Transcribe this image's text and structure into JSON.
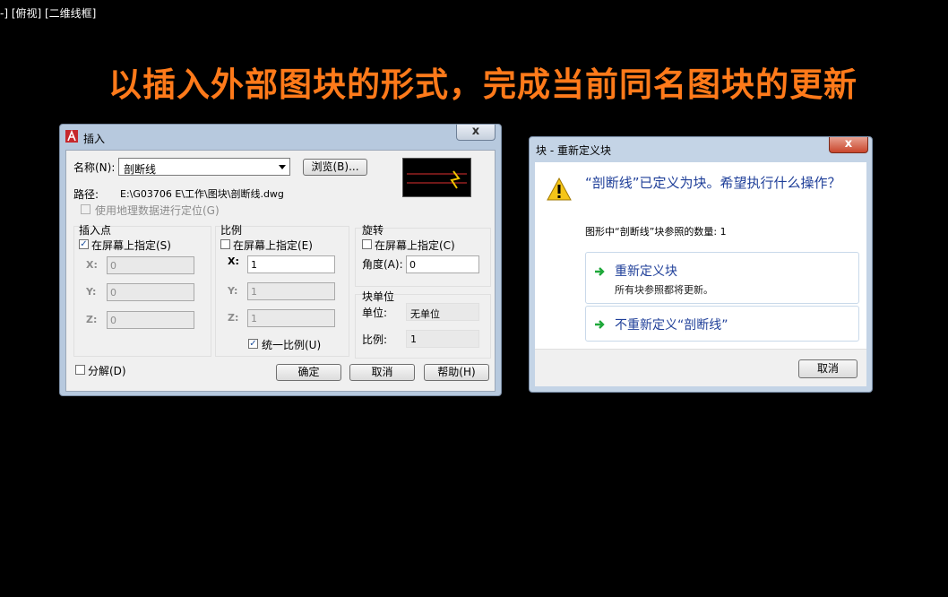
{
  "viewport_label": "-] [俯视] [二维线框]",
  "headline": "以插入外部图块的形式，完成当前同名图块的更新",
  "insert_dialog": {
    "title": "插入",
    "close_symbol": "x",
    "name_label": "名称(N):",
    "name_value": "剖断线",
    "browse_label": "浏览(B)...",
    "path_label": "路径:",
    "path_value": "E:\\G03706 E\\工作\\图块\\剖断线.dwg",
    "geo_label": "使用地理数据进行定位(G)",
    "insertion_point": {
      "title": "插入点",
      "specify_label": "在屏幕上指定(S)",
      "specify_checked": true,
      "x_label": "X:",
      "x_value": "0",
      "y_label": "Y:",
      "y_value": "0",
      "z_label": "Z:",
      "z_value": "0"
    },
    "scale": {
      "title": "比例",
      "specify_label": "在屏幕上指定(E)",
      "specify_checked": false,
      "x_label": "X:",
      "x_value": "1",
      "y_label": "Y:",
      "y_value": "1",
      "z_label": "Z:",
      "z_value": "1",
      "uniform_label": "统一比例(U)",
      "uniform_checked": true
    },
    "rotation": {
      "title": "旋转",
      "specify_label": "在屏幕上指定(C)",
      "specify_checked": false,
      "angle_label": "角度(A):",
      "angle_value": "0"
    },
    "block_unit": {
      "title": "块单位",
      "unit_label": "单位:",
      "unit_value": "无单位",
      "factor_label": "比例:",
      "factor_value": "1"
    },
    "explode_label": "分解(D)",
    "explode_checked": false,
    "ok_label": "确定",
    "cancel_label": "取消",
    "help_label": "帮助(H)"
  },
  "redefine_dialog": {
    "title": "块 - 重新定义块",
    "close_symbol": "x",
    "question": "“剖断线”已定义为块。希望执行什么操作？",
    "ref_count": "图形中“剖断线”块参照的数量: 1",
    "option1_title": "重新定义块",
    "option1_desc": "所有块参照都将更新。",
    "option2_title": "不重新定义“剖断线”",
    "cancel_label": "取消"
  },
  "colors": {
    "headline": "#ff7a1a",
    "link_blue": "#1f3f99",
    "arrow_green": "#1fa83a"
  }
}
